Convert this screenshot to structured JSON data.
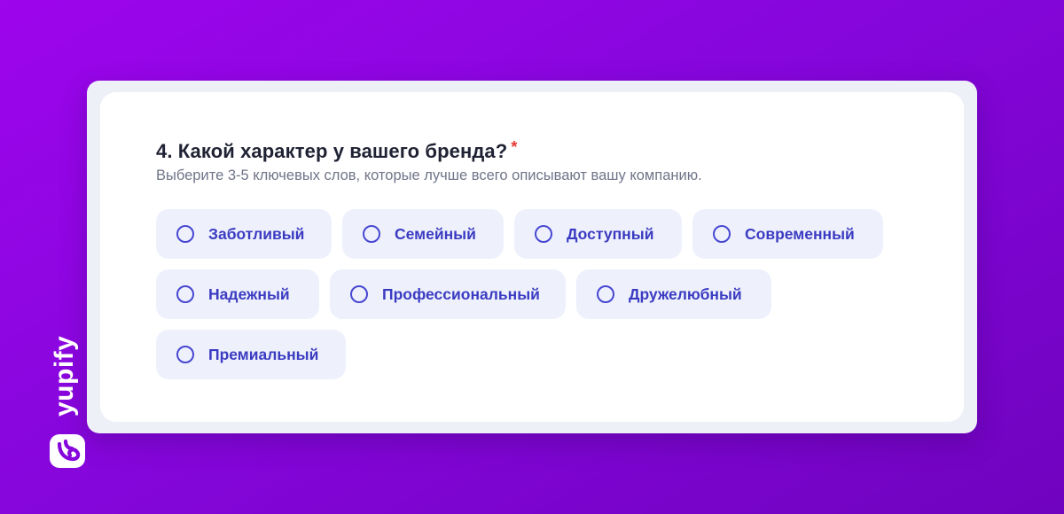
{
  "question": {
    "number_title": "4. Какой характер у вашего бренда?",
    "required_mark": "*",
    "hint": "Выберите 3-5 ключевых слов, которые лучше всего описывают вашу компанию."
  },
  "options": [
    {
      "label": "Заботливый",
      "selected": false
    },
    {
      "label": "Семейный",
      "selected": false
    },
    {
      "label": "Доступный",
      "selected": false
    },
    {
      "label": "Современный",
      "selected": false
    },
    {
      "label": "Надежный",
      "selected": false
    },
    {
      "label": "Профессиональный",
      "selected": false
    },
    {
      "label": "Дружелюбный",
      "selected": false
    },
    {
      "label": "Премиальный",
      "selected": false
    }
  ],
  "brand": {
    "name": "yupify",
    "logo_icon": "yupify-logo-icon"
  },
  "colors": {
    "background_start": "#9d05ec",
    "background_end": "#7003bf",
    "option_background": "#eef1fc",
    "accent": "#3b3bc2",
    "required": "#e53935"
  }
}
